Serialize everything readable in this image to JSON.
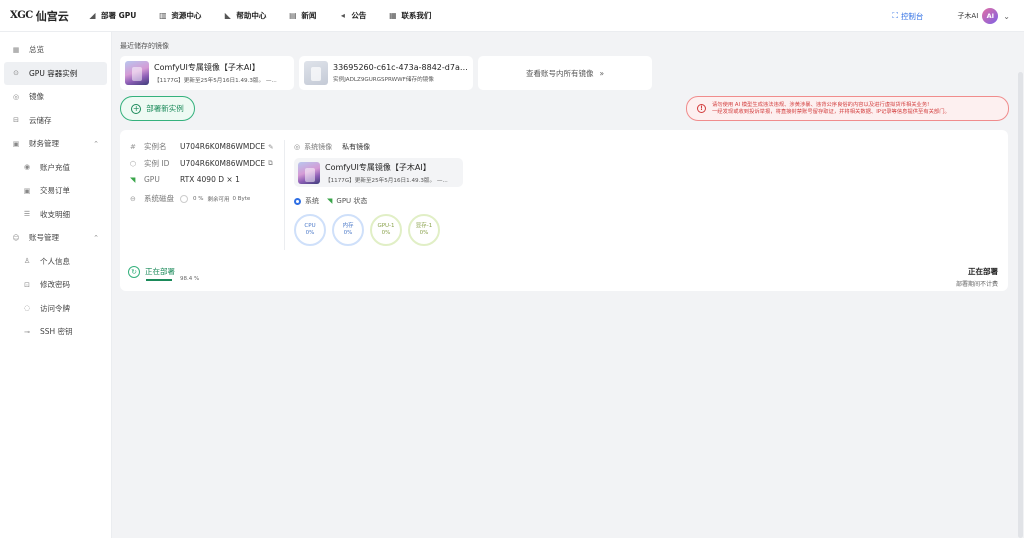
{
  "brand": {
    "mark": "XGC",
    "name": "仙宫云"
  },
  "nav": [
    {
      "icon": "gpu-icon",
      "label": "部署 GPU"
    },
    {
      "icon": "resource-icon",
      "label": "资源中心"
    },
    {
      "icon": "help-icon",
      "label": "帮助中心"
    },
    {
      "icon": "news-icon",
      "label": "新闻"
    },
    {
      "icon": "announcement-icon",
      "label": "公告"
    },
    {
      "icon": "contact-icon",
      "label": "联系我们"
    }
  ],
  "topright": {
    "console": "控制台",
    "user": "子木AI",
    "avatar": "AI"
  },
  "sidebar": [
    {
      "icon": "overview-icon",
      "label": "总览",
      "active": false
    },
    {
      "icon": "gpu-instance-icon",
      "label": "GPU 容器实例",
      "active": true
    },
    {
      "icon": "image-icon",
      "label": "镜像"
    },
    {
      "icon": "cloud-storage-icon",
      "label": "云储存"
    },
    {
      "icon": "finance-icon",
      "label": "财务管理",
      "expanded": true
    },
    {
      "icon": "recharge-icon",
      "label": "账户充值",
      "sub": true
    },
    {
      "icon": "orders-icon",
      "label": "交易订单",
      "sub": true
    },
    {
      "icon": "details-icon",
      "label": "收支明细",
      "sub": true
    },
    {
      "icon": "account-icon",
      "label": "账号管理",
      "expanded": true
    },
    {
      "icon": "profile-icon",
      "label": "个人信息",
      "sub": true
    },
    {
      "icon": "password-icon",
      "label": "修改密码",
      "sub": true
    },
    {
      "icon": "token-icon",
      "label": "访问令牌",
      "sub": true
    },
    {
      "icon": "ssh-key-icon",
      "label": "SSH 密钥",
      "sub": true
    }
  ],
  "recent": {
    "title": "最近储存的镜像",
    "cards": [
      {
        "title": "ComfyUI专属镜像【子木AI】",
        "sub": "【1177G】更新至25年5月16日1.49.3版。 —..."
      },
      {
        "title": "33695260-c61c-473a-8842-d7a9a4...",
        "sub": "实例JADLZ9GURGSPRWWF储存的镜像"
      }
    ],
    "view_all": "查看账号内所有镜像"
  },
  "deploy_button": "部署新实例",
  "warning": {
    "line1": "请勿使用 AI 模型生成违法违规、涉黄涉暴、违背公序良俗的内容以及进行虚拟货币相关业务!",
    "line2": "一经发现或收到投诉举报，将直接封禁账号留存取证，并将相关数据、IP记录等信息提供至有关部门。"
  },
  "instance": {
    "name_label": "实例名",
    "name": "U704R6K0M86WMDCE",
    "id_label": "实例 ID",
    "id": "U704R6K0M86WMDCE",
    "gpu_label": "GPU",
    "gpu": "RTX 4090 D × 1",
    "disk_label": "系统磁盘",
    "disk_pct": "0 %",
    "disk_free": "剩余可用",
    "disk_size": "0 Byte",
    "mirror_label": "系统镜像",
    "mirror_type": "私有镜像",
    "mirror_title": "ComfyUI专属镜像【子木AI】",
    "mirror_sub": "【1177G】更新至25年5月16日1.49.3版。 —...",
    "tab_system": "系统",
    "tab_gpu": "GPU 状态",
    "gauges": [
      {
        "label": "CPU",
        "value": "0%",
        "tone": "blue"
      },
      {
        "label": "内存",
        "value": "0%",
        "tone": "blue"
      },
      {
        "label": "GPU-1",
        "value": "0%",
        "tone": "green"
      },
      {
        "label": "显存-1",
        "value": "0%",
        "tone": "green"
      }
    ],
    "status": "正在部署",
    "progress": "98.4 %",
    "progress_value": 0.984,
    "status_right": "正在部署",
    "status_right_sub": "部署期间不计费"
  }
}
